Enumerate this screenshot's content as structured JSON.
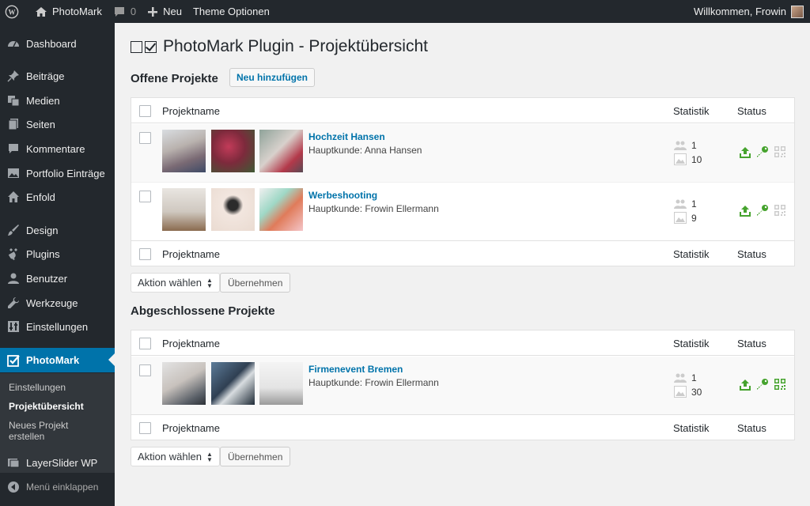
{
  "adminbar": {
    "site_name": "PhotoMark",
    "comments_count": "0",
    "new_label": "Neu",
    "theme_options_label": "Theme Optionen",
    "welcome_text": "Willkommen, Frowin"
  },
  "sidebar": {
    "items": {
      "dashboard": "Dashboard",
      "beitraege": "Beiträge",
      "medien": "Medien",
      "seiten": "Seiten",
      "kommentare": "Kommentare",
      "portfolio": "Portfolio Einträge",
      "enfold": "Enfold",
      "design": "Design",
      "plugins": "Plugins",
      "benutzer": "Benutzer",
      "werkzeuge": "Werkzeuge",
      "einstellungen": "Einstellungen",
      "photomark": "PhotoMark",
      "layerslider": "LayerSlider WP",
      "collapse": "Menü einklappen"
    },
    "submenu": {
      "einstellungen": "Einstellungen",
      "projektuebersicht": "Projektübersicht",
      "neues_projekt": "Neues Projekt erstellen"
    }
  },
  "page": {
    "title": "PhotoMark Plugin - Projektübersicht",
    "open_section_title": "Offene Projekte",
    "add_new_label": "Neu hinzufügen",
    "closed_section_title": "Abgeschlossene Projekte"
  },
  "table": {
    "col_name": "Projektname",
    "col_stat": "Statistik",
    "col_status": "Status"
  },
  "open_projects": [
    {
      "title": "Hochzeit Hansen",
      "client": "Hauptkunde: Anna Hansen",
      "persons": "1",
      "images": "10"
    },
    {
      "title": "Werbeshooting",
      "client": "Hauptkunde: Frowin Ellermann",
      "persons": "1",
      "images": "9"
    }
  ],
  "closed_projects": [
    {
      "title": "Firmenevent Bremen",
      "client": "Hauptkunde: Frowin Ellermann",
      "persons": "1",
      "images": "30"
    }
  ],
  "bulk": {
    "action_label": "Aktion wählen",
    "apply_label": "Übernehmen"
  },
  "colors": {
    "accent": "#0073aa",
    "sidebar_bg": "#23282d",
    "status_green": "#46a32e",
    "link_blue": "#0073aa"
  },
  "icons": {
    "stat_persons": "people-icon",
    "stat_images": "images-icon",
    "status_publish": "upload-icon",
    "status_access": "key-icon",
    "status_qr": "qr-code-icon"
  }
}
